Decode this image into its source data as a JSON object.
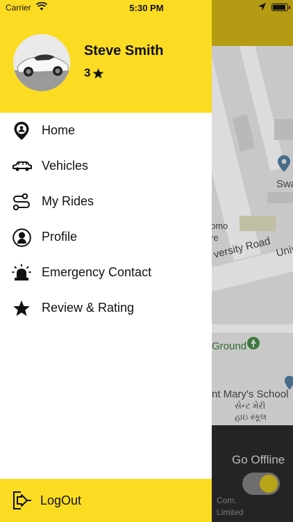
{
  "status_bar": {
    "carrier": "Carrier",
    "time": "5:30 PM"
  },
  "user": {
    "name": "Steve Smith",
    "rating": "3"
  },
  "menu": {
    "items": [
      {
        "label": "Home",
        "icon": "home-pin-icon"
      },
      {
        "label": "Vehicles",
        "icon": "car-icon"
      },
      {
        "label": "My Rides",
        "icon": "route-icon"
      },
      {
        "label": "Profile",
        "icon": "profile-icon"
      },
      {
        "label": "Emergency Contact",
        "icon": "siren-icon"
      },
      {
        "label": "Review & Rating",
        "icon": "star-icon"
      }
    ]
  },
  "logout": {
    "label": "LogOut"
  },
  "background": {
    "map_labels": {
      "swa": "Swa",
      "omo": "omo",
      "re": "re",
      "university_road": "versity Road",
      "univ": "Univ",
      "ground": "Ground",
      "school": "nt Mary's School",
      "school_gujarati_1": "સેન્ટ મેરી",
      "school_gujarati_2": "હાઇ સ્કૂલ"
    },
    "go_offline": "Go Offline",
    "footnote_1": "Com.",
    "footnote_2": "Limited"
  },
  "colors": {
    "accent": "#fcdc22",
    "dim_header": "#b49b13",
    "bottom_panel": "#242424"
  }
}
